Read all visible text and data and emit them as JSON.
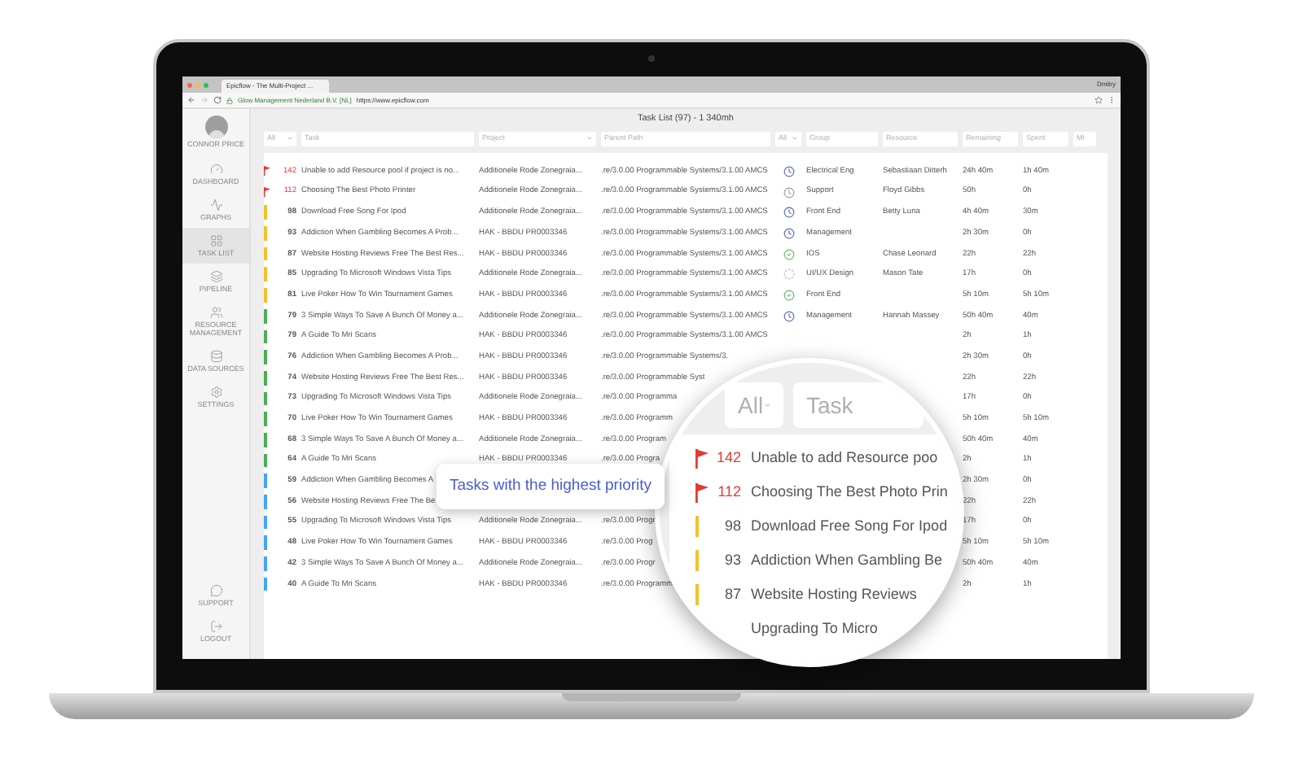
{
  "browser": {
    "tab_title": "Epicflow - The Multi-Project ...",
    "user": "Dmitry",
    "site_identity": "Glow Management Nederland B.V. [NL]",
    "url": "https://www.epicflow.com"
  },
  "sidebar": {
    "user_name": "CONNOR PRICE",
    "items": [
      {
        "label": "DASHBOARD",
        "selected": false
      },
      {
        "label": "GRAPHS",
        "selected": false
      },
      {
        "label": "TASK LIST",
        "selected": true
      },
      {
        "label": "PIPELINE",
        "selected": false
      },
      {
        "label": "RESOURCE MANAGEMENT",
        "selected": false
      },
      {
        "label": "DATA SOURCES",
        "selected": false
      },
      {
        "label": "SETTINGS",
        "selected": false
      }
    ],
    "bottom_items": [
      {
        "label": "SUPPORT",
        "selected": false
      },
      {
        "label": "LOGOUT",
        "selected": false
      }
    ]
  },
  "title": "Task List (97) - 1 340mh",
  "filters": [
    {
      "kind": "select",
      "value": "All"
    },
    {
      "kind": "input",
      "placeholder": "Task"
    },
    {
      "kind": "select",
      "placeholder": "Project"
    },
    {
      "kind": "input",
      "placeholder": "Parent Path"
    },
    {
      "kind": "select",
      "value": "All"
    },
    {
      "kind": "input",
      "placeholder": "Group"
    },
    {
      "kind": "input",
      "placeholder": "Resource"
    },
    {
      "kind": "input",
      "placeholder": "Remaining"
    },
    {
      "kind": "input",
      "placeholder": "Spent"
    },
    {
      "kind": "input",
      "placeholder": "Mi"
    }
  ],
  "rows": [
    {
      "priority": "142",
      "flagged": true,
      "color": "#e53935",
      "task": "Unable to add Resource pool if project is no...",
      "project": "Additionele Rode Zonegraia...",
      "path": ".re/3.0.00 Programmable Systems/3.1.00 AMCS",
      "kind": "scheduled",
      "group": "Electrical Eng",
      "resource": "Sebastiaan Ditterh",
      "remaining": "24h 40m",
      "spent": "1h 40m"
    },
    {
      "priority": "112",
      "flagged": true,
      "color": "#e53935",
      "task": "Choosing The Best Photo Printer",
      "project": "Additionele Rode Zonegraia...",
      "path": ".re/3.0.00 Programmable Systems/3.1.00 AMCS",
      "kind": "pending",
      "group": "Support",
      "resource": "Floyd Gibbs",
      "remaining": "50h",
      "spent": "0h"
    },
    {
      "priority": "98",
      "flagged": false,
      "color": "#f5c02c",
      "task": "Download Free Song For Ipod",
      "project": "Additionele Rode Zonegraia...",
      "path": ".re/3.0.00 Programmable Systems/3.1.00 AMCS",
      "kind": "scheduled",
      "group": "Front End",
      "resource": "Betty Luna",
      "remaining": "4h 40m",
      "spent": "30m"
    },
    {
      "priority": "93",
      "flagged": false,
      "color": "#f5c02c",
      "task": "Addiction When Gambling Becomes A Prob...",
      "project": "HAK - BBDU PR0003346",
      "path": ".re/3.0.00 Programmable Systems/3.1.00 AMCS",
      "kind": "scheduled",
      "group": "Management",
      "remaining": "2h 30m",
      "spent": "0h"
    },
    {
      "priority": "87",
      "flagged": false,
      "color": "#f5c02c",
      "task": "Website Hosting Reviews Free The Best Res...",
      "project": "HAK - BBDU PR0003346",
      "path": ".re/3.0.00 Programmable Systems/3.1.00 AMCS",
      "kind": "done",
      "group": "IOS",
      "resource": "Chase Leonard",
      "remaining": "22h",
      "spent": "22h"
    },
    {
      "priority": "85",
      "flagged": false,
      "color": "#f5c02c",
      "task": "Upgrading To Microsoft Windows Vista Tips",
      "project": "Additionele Rode Zonegraia...",
      "path": ".re/3.0.00 Programmable Systems/3.1.00 AMCS",
      "kind": "waiting",
      "group": "UI/UX Design",
      "resource": "Mason Tate",
      "remaining": "17h",
      "spent": "0h"
    },
    {
      "priority": "81",
      "flagged": false,
      "color": "#f5c02c",
      "task": "Live Poker How To Win Tournament Games",
      "project": "HAK - BBDU PR0003346",
      "path": ".re/3.0.00 Programmable Systems/3.1.00 AMCS",
      "kind": "done",
      "group": "Front End",
      "remaining": "5h 10m",
      "spent": "5h 10m"
    },
    {
      "priority": "79",
      "flagged": false,
      "color": "#4caf50",
      "task": "3 Simple Ways To Save A Bunch Of Money a...",
      "project": "Additionele Rode Zonegraia...",
      "path": ".re/3.0.00 Programmable Systems/3.1.00 AMCS",
      "kind": "scheduled",
      "group": "Management",
      "resource": "Hannah Massey",
      "remaining": "50h 40m",
      "spent": "40m"
    },
    {
      "priority": "79",
      "flagged": false,
      "color": "#4caf50",
      "task": "A Guide To Mri Scans",
      "project": "HAK - BBDU PR0003346",
      "path": ".re/3.0.00 Programmable Systems/3.1.00 AMCS",
      "remaining": "2h",
      "spent": "1h"
    },
    {
      "priority": "76",
      "flagged": false,
      "color": "#4caf50",
      "task": "Addiction When Gambling Becomes A Prob...",
      "project": "HAK - BBDU PR0003346",
      "path": ".re/3.0.00 Programmable Systems/3.",
      "remaining": "2h 30m",
      "spent": "0h"
    },
    {
      "priority": "74",
      "flagged": false,
      "color": "#4caf50",
      "task": "Website Hosting Reviews Free The Best Res...",
      "project": "HAK - BBDU PR0003346",
      "path": ".re/3.0.00 Programmable Syst",
      "remaining": "22h",
      "spent": "22h"
    },
    {
      "priority": "73",
      "flagged": false,
      "color": "#4caf50",
      "task": "Upgrading To Microsoft Windows Vista Tips",
      "project": "Additionele Rode Zonegraia...",
      "path": ".re/3.0.00 Programma",
      "remaining": "17h",
      "spent": "0h"
    },
    {
      "priority": "70",
      "flagged": false,
      "color": "#4caf50",
      "task": "Live Poker How To Win Tournament Games",
      "project": "HAK - BBDU PR0003346",
      "path": ".re/3.0.00 Programm",
      "remaining": "5h 10m",
      "spent": "5h 10m"
    },
    {
      "priority": "68",
      "flagged": false,
      "color": "#4caf50",
      "task": "3 Simple Ways To Save A Bunch Of Money a...",
      "project": "Additionele Rode Zonegraia...",
      "path": ".re/3.0.00 Program",
      "remaining": "50h 40m",
      "spent": "40m"
    },
    {
      "priority": "64",
      "flagged": false,
      "color": "#4caf50",
      "task": "A Guide To Mri Scans",
      "project": "HAK - BBDU PR0003346",
      "path": ".re/3.0.00 Progra",
      "remaining": "2h",
      "spent": "1h"
    },
    {
      "priority": "59",
      "flagged": false,
      "color": "#42a5f5",
      "task": "Addiction When Gambling Becomes A",
      "remaining": "2h 30m",
      "spent": "0h"
    },
    {
      "priority": "56",
      "flagged": false,
      "color": "#42a5f5",
      "task": "Website Hosting Reviews Free The Be",
      "remaining": "22h",
      "spent": "22h"
    },
    {
      "priority": "55",
      "flagged": false,
      "color": "#42a5f5",
      "task": "Upgrading To Microsoft Windows Vista Tips",
      "project": "Additionele Rode Zonegraia...",
      "path": ".re/3.0.00 Progr",
      "remaining": "17h",
      "spent": "0h"
    },
    {
      "priority": "48",
      "flagged": false,
      "color": "#42a5f5",
      "task": "Live Poker How To Win Tournament Games",
      "project": "HAK - BBDU PR0003346",
      "path": ".re/3.0.00 Prog",
      "remaining": "5h 10m",
      "spent": "5h 10m"
    },
    {
      "priority": "42",
      "flagged": false,
      "color": "#42a5f5",
      "task": "3 Simple Ways To Save A Bunch Of Money a...",
      "project": "Additionele Rode Zonegraia...",
      "path": ".re/3.0.00 Progr",
      "remaining": "50h 40m",
      "spent": "40m"
    },
    {
      "priority": "40",
      "flagged": false,
      "color": "#42a5f5",
      "task": "A Guide To Mri Scans",
      "project": "HAK - BBDU PR0003346",
      "path": ".re/3.0.00 Programm",
      "remaining": "2h",
      "spent": "1h"
    }
  ],
  "magnifier": {
    "filters": [
      {
        "kind": "select",
        "value": "All"
      },
      {
        "kind": "input",
        "placeholder": "Task"
      }
    ],
    "rows": [
      {
        "priority": "142",
        "flagged": true,
        "color": "#e53935",
        "task": "Unable to add Resource poo"
      },
      {
        "priority": "112",
        "flagged": true,
        "color": "#e53935",
        "task": "Choosing The Best Photo Prin"
      },
      {
        "priority": "98",
        "flagged": false,
        "color": "#f5c02c",
        "task": "Download Free Song For Ipod"
      },
      {
        "priority": "93",
        "flagged": false,
        "color": "#f5c02c",
        "task": "Addiction When Gambling Be"
      },
      {
        "priority": "87",
        "flagged": false,
        "color": "#f5c02c",
        "task": "Website Hosting Reviews"
      },
      {
        "task": "Upgrading To Micro"
      }
    ]
  },
  "callout": "Tasks with the highest priority"
}
